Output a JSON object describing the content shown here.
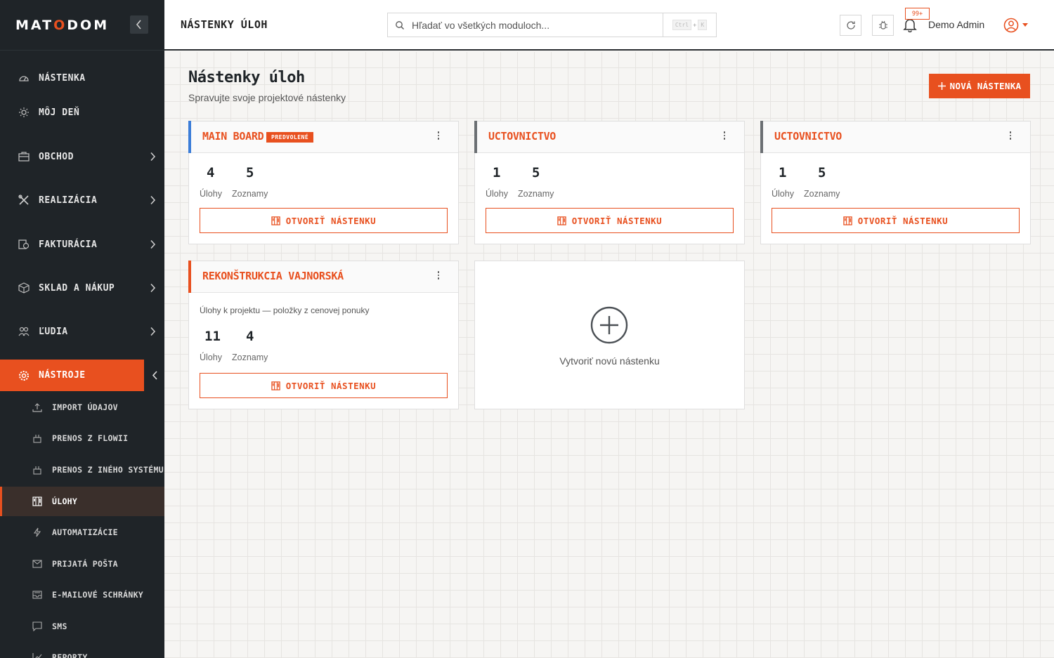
{
  "brand": {
    "logo_part1": "MAT",
    "logo_o": "O",
    "logo_part2": "DOM"
  },
  "sidebar": {
    "items": [
      {
        "label": "NÁSTENKA"
      },
      {
        "label": "MÔJ DEŇ"
      },
      {
        "label": "OBCHOD"
      },
      {
        "label": "REALIZÁCIA"
      },
      {
        "label": "FAKTURÁCIA"
      },
      {
        "label": "SKLAD A NÁKUP"
      },
      {
        "label": "ĽUDIA"
      },
      {
        "label": "NÁSTROJE"
      }
    ],
    "sub_items": [
      {
        "label": "IMPORT ÚDAJOV"
      },
      {
        "label": "PRENOS Z FLOWII"
      },
      {
        "label": "PRENOS Z INÉHO SYSTÉMU"
      },
      {
        "label": "ÚLOHY"
      },
      {
        "label": "AUTOMATIZÁCIE"
      },
      {
        "label": "PRIJATÁ POŠTA"
      },
      {
        "label": "E-MAILOVÉ SCHRÁNKY"
      },
      {
        "label": "SMS"
      },
      {
        "label": "REPORTY"
      }
    ]
  },
  "topbar": {
    "page_label": "NÁSTENKY ÚLOH",
    "search_placeholder": "Hľadať vo všetkých moduloch...",
    "kbd_ctrl": "Ctrl",
    "kbd_plus": "+",
    "kbd_k": "K",
    "notification_count": "99+",
    "user_name": "Demo Admin"
  },
  "main": {
    "title": "Nástenky úloh",
    "subtitle": "Spravujte svoje projektové nástenky",
    "new_button_label": "NOVÁ NÁSTENKA",
    "open_label": "OTVORIŤ NÁSTENKU",
    "stat_tasks_label": "Úlohy",
    "stat_lists_label": "Zoznamy",
    "boards": [
      {
        "title": "MAIN BOARD",
        "tag": "PREDVOLENÉ",
        "tasks": "4",
        "lists": "5",
        "accent": "#3b7dd8"
      },
      {
        "title": "UCTOVNICTVO",
        "tasks": "1",
        "lists": "5",
        "accent": "#6b6f73"
      },
      {
        "title": "UCTOVNICTVO",
        "tasks": "1",
        "lists": "5",
        "accent": "#6b6f73"
      },
      {
        "title": "REKONŠTRUKCIA VAJNORSKÁ",
        "description": "Úlohy k projektu — položky z cenovej ponuky",
        "tasks": "11",
        "lists": "4",
        "accent": "#e8501f"
      }
    ],
    "create_label": "Vytvoriť novú nástenku"
  },
  "colors": {
    "accent": "#e8501f",
    "sidebar_bg": "#1f2428"
  }
}
